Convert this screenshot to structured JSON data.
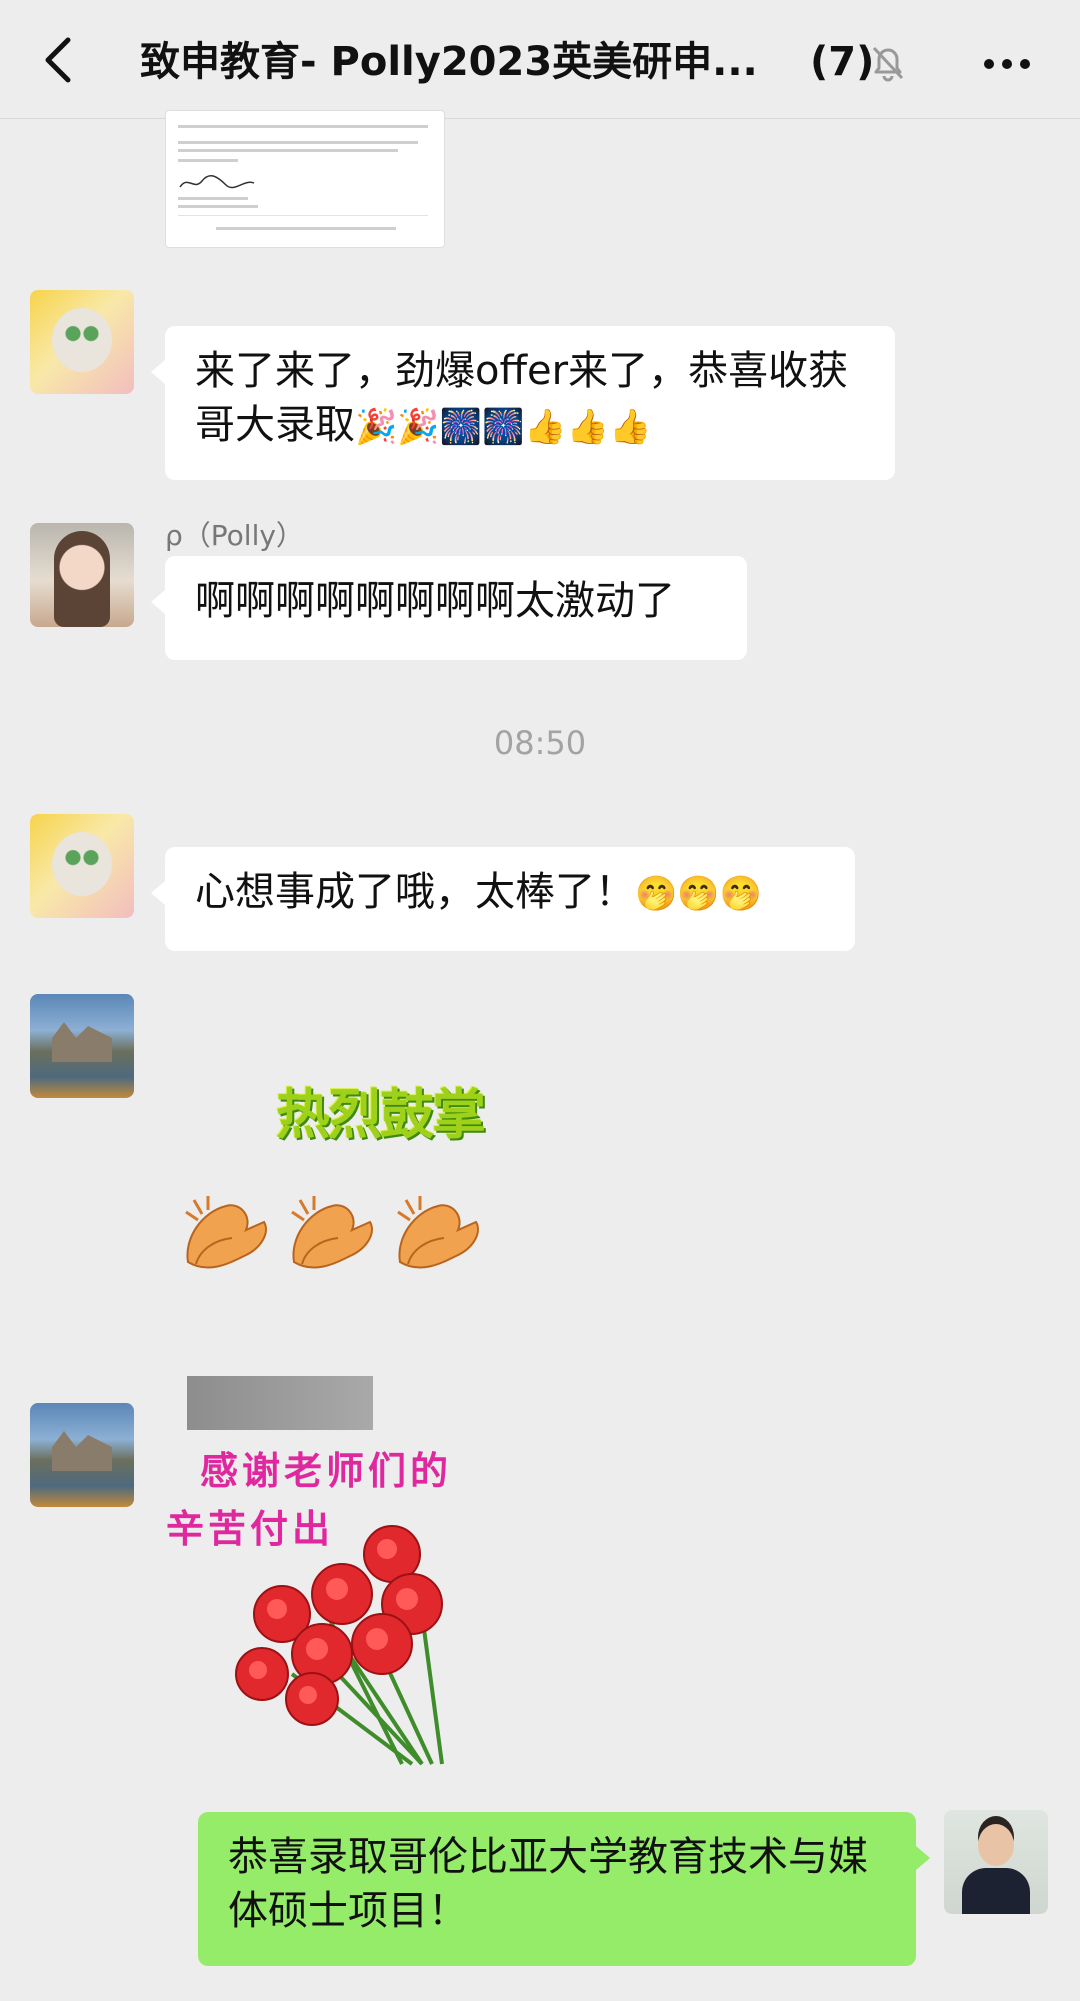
{
  "header": {
    "title": "致申教育- Polly2023英美研申...",
    "member_count": "(7)"
  },
  "icons": {
    "back": "chevron-left-icon",
    "mute": "bell-off-icon",
    "more": "more-dots-icon"
  },
  "messages": [
    {
      "sender": "",
      "text": "来了来了，劲爆offer来了，恭喜收获哥大录取",
      "emoji": "🎉🎉🎆🎆👍👍👍"
    },
    {
      "sender": "ρ（Polly）",
      "text": "啊啊啊啊啊啊啊啊太激动了",
      "emoji": ""
    },
    {
      "sender": "",
      "text": "心想事成了哦，太棒了！",
      "emoji": "🤭🤭🤭"
    },
    {
      "sender": "",
      "text": "恭喜录取哥伦比亚大学教育技术与媒体硕士项目！",
      "emoji": ""
    }
  ],
  "timestamp": "08:50",
  "stickers": {
    "applause": "热烈鼓掌",
    "thanks_line1": "感谢老师们的",
    "thanks_line2": "辛苦付出"
  },
  "colors": {
    "background": "#ededed",
    "bubble_white": "#ffffff",
    "bubble_green": "#95ec69",
    "timestamp": "#a3a3a3"
  }
}
